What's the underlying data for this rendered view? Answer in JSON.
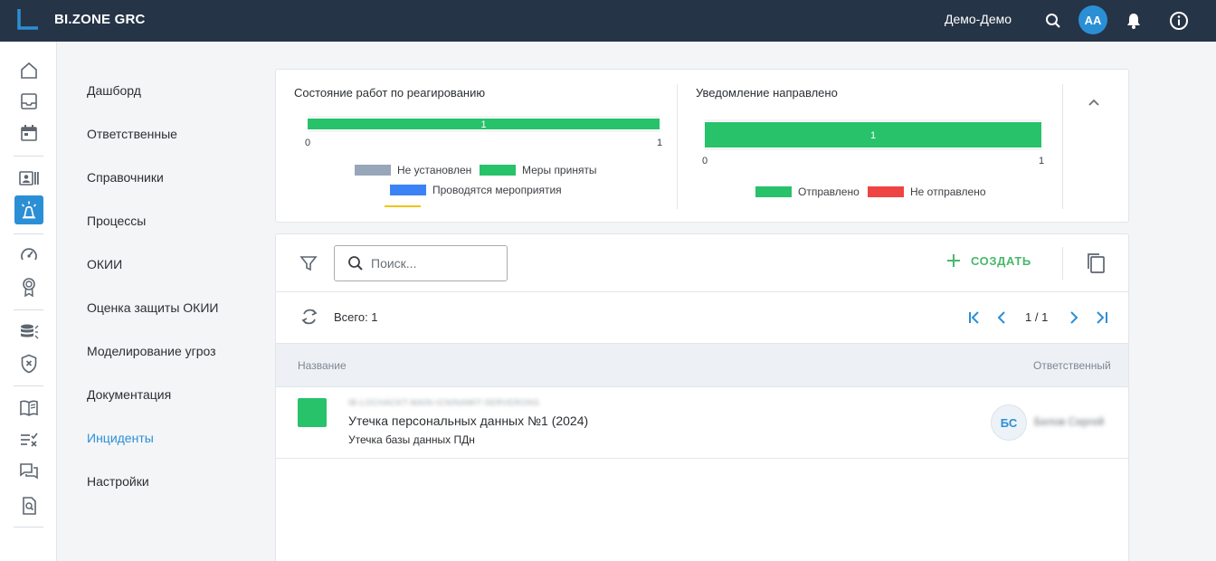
{
  "app": {
    "brand": "BI.ZONE GRC",
    "user_name": "Демо-Демо",
    "user_initials": "АА"
  },
  "colors": {
    "topbar": "#263447",
    "accent": "#2b8fd6",
    "green": "#27c26a",
    "gray": "#98a6ba",
    "blue": "#3b82f6",
    "red": "#ef4444",
    "yellow": "#f1c40f"
  },
  "rail": {
    "icons": [
      "home-icon",
      "inbox-icon",
      "calendar-icon",
      "id-card-icon",
      "incident-alarm-icon",
      "gauge-icon",
      "award-icon",
      "database-icon",
      "shield-x-icon",
      "book-icon",
      "checklist-icon",
      "chat-icon",
      "document-search-icon"
    ]
  },
  "nav": {
    "items": [
      "Дашборд",
      "Ответственные",
      "Справочники",
      "Процессы",
      "ОКИИ",
      "Оценка защиты ОКИИ",
      "Моделирование угроз",
      "Документация",
      "Инциденты",
      "Настройки"
    ],
    "active": "Инциденты"
  },
  "chart_data": [
    {
      "type": "bar",
      "orientation": "horizontal",
      "stacked": true,
      "title": "Состояние работ по реагированию",
      "categories": [
        ""
      ],
      "series": [
        {
          "name": "Не установлен",
          "values": [
            0
          ],
          "color": "#98a6ba"
        },
        {
          "name": "Меры приняты",
          "values": [
            1
          ],
          "color": "#27c26a"
        },
        {
          "name": "Проводятся мероприятия",
          "values": [
            0
          ],
          "color": "#3b82f6"
        }
      ],
      "data_labels": [
        "1"
      ],
      "xlim": [
        0,
        1
      ],
      "x_ticks": [
        "0",
        "1"
      ],
      "legend": "bottom"
    },
    {
      "type": "bar",
      "orientation": "horizontal",
      "stacked": true,
      "title": "Уведомление направлено",
      "categories": [
        ""
      ],
      "series": [
        {
          "name": "Отправлено",
          "values": [
            1
          ],
          "color": "#27c26a"
        },
        {
          "name": "Не отправлено",
          "values": [
            0
          ],
          "color": "#ef4444"
        }
      ],
      "data_labels": [
        "1"
      ],
      "xlim": [
        0,
        1
      ],
      "x_ticks": [
        "0",
        "1"
      ],
      "legend": "bottom"
    }
  ],
  "toolbar": {
    "search_placeholder": "Поиск...",
    "create_label": "СОЗДАТЬ"
  },
  "list": {
    "total_label": "Всего: 1",
    "page_label": "1 / 1",
    "columns": [
      "Название",
      "Ответственный"
    ],
    "rows": [
      {
        "id_text": "IB-LOCHACKT-MAIN-ICNINAMIT-SERVERONS",
        "title": "Утечка персональных данных №1 (2024)",
        "subtitle": "Утечка базы данных ПДн",
        "status_color": "#27c26a",
        "responsible_initials": "БС",
        "responsible_name": "Белов Сергей"
      }
    ]
  }
}
